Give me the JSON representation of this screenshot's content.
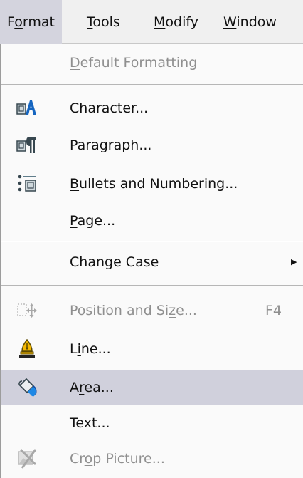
{
  "menubar": {
    "items": [
      {
        "pre": "F",
        "u": "o",
        "post": "rmat"
      },
      {
        "pre": "",
        "u": "T",
        "post": "ools"
      },
      {
        "pre": "",
        "u": "M",
        "post": "odify"
      },
      {
        "pre": "",
        "u": "W",
        "post": "indow"
      }
    ]
  },
  "menu": {
    "default_formatting": {
      "pre": "",
      "u": "D",
      "post": "efault Formatting"
    },
    "character": {
      "pre": "C",
      "u": "h",
      "post": "aracter..."
    },
    "paragraph": {
      "pre": "P",
      "u": "a",
      "post": "ragraph..."
    },
    "bullets": {
      "pre": "",
      "u": "B",
      "post": "ullets and Numbering..."
    },
    "page": {
      "pre": "",
      "u": "P",
      "post": "age..."
    },
    "change_case": {
      "pre": "",
      "u": "C",
      "post": "hange Case"
    },
    "position_size": {
      "pre": "Position and Si",
      "u": "z",
      "post": "e...",
      "shortcut": "F4"
    },
    "line": {
      "pre": "L",
      "u": "i",
      "post": "ne..."
    },
    "area": {
      "pre": "A",
      "u": "r",
      "post": "ea..."
    },
    "text": {
      "pre": "Te",
      "u": "x",
      "post": "t..."
    },
    "crop_picture": {
      "pre": "Cr",
      "u": "o",
      "post": "p Picture..."
    }
  },
  "colors": {
    "highlight": "#d0d0dc",
    "disabled_text": "#8f8f8f"
  }
}
